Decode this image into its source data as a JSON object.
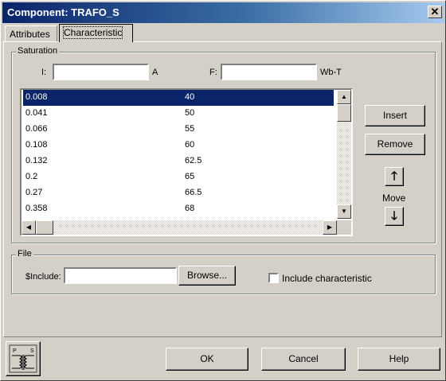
{
  "window": {
    "title": "Component: TRAFO_S",
    "close_glyph": "✕"
  },
  "tabs": [
    {
      "label": "Attributes",
      "active": false
    },
    {
      "label": "Characteristic",
      "active": true
    }
  ],
  "saturation": {
    "legend": "Saturation",
    "i_label": "I:",
    "i_value": "",
    "i_unit": "A",
    "f_label": "F:",
    "f_value": "",
    "f_unit": "Wb-T",
    "rows": [
      {
        "i": "0.008",
        "f": "40",
        "selected": true
      },
      {
        "i": "0.041",
        "f": "50",
        "selected": false
      },
      {
        "i": "0.066",
        "f": "55",
        "selected": false
      },
      {
        "i": "0.108",
        "f": "60",
        "selected": false
      },
      {
        "i": "0.132",
        "f": "62.5",
        "selected": false
      },
      {
        "i": "0.2",
        "f": "65",
        "selected": false
      },
      {
        "i": "0.27",
        "f": "66.5",
        "selected": false
      },
      {
        "i": "0.358",
        "f": "68",
        "selected": false
      }
    ],
    "insert_label": "Insert",
    "remove_label": "Remove",
    "move_label": "Move"
  },
  "file": {
    "legend": "File",
    "include_label": "$Include:",
    "include_value": "",
    "browse_label": "Browse...",
    "include_char_label": "Include characteristic",
    "include_char_checked": false
  },
  "footer": {
    "ok_label": "OK",
    "cancel_label": "Cancel",
    "help_label": "Help"
  },
  "icons": [
    "close-icon",
    "arrow-up-icon",
    "arrow-down-icon",
    "scroll-up-icon",
    "scroll-down-icon",
    "scroll-left-icon",
    "scroll-right-icon",
    "transformer-icon"
  ]
}
